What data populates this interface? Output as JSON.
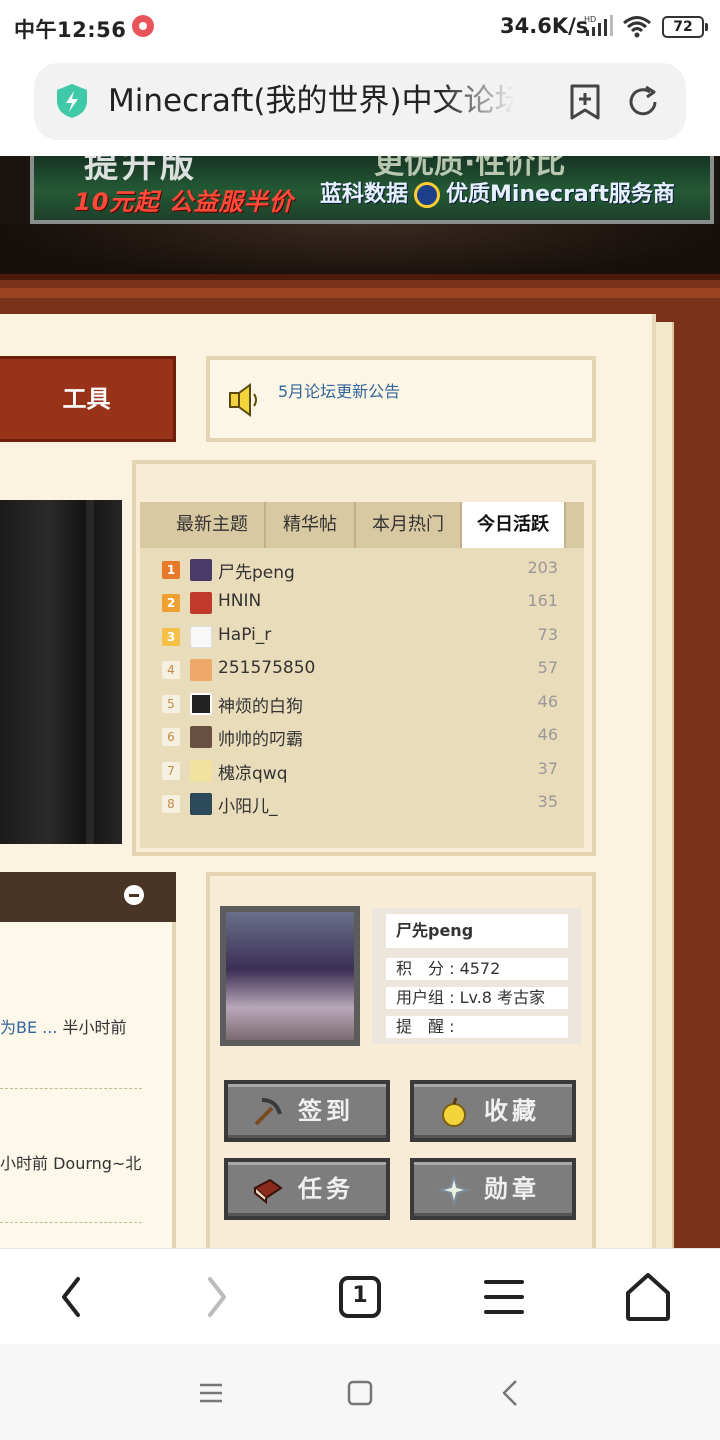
{
  "status_bar": {
    "time": "中午12:56",
    "net_speed": "34.6K/s",
    "battery": "72",
    "icons": [
      "record-icon",
      "signal-hd-icon",
      "wifi-icon",
      "battery-icon"
    ]
  },
  "address_bar": {
    "title": "Minecraft(我的世界)中文论坛",
    "icons": [
      "shield-icon",
      "bookmark-add-icon",
      "reload-icon"
    ]
  },
  "banner": {
    "headline": "提升版",
    "headline_right": "更优质·性价比",
    "left_text": "10元起 公益服半价",
    "right_text_a": "蓝科数据",
    "right_text_b": "优质Minecraft服务商"
  },
  "toolbar": {
    "tools_label": "工具"
  },
  "notice": {
    "link": "5月论坛更新公告"
  },
  "tabs": [
    {
      "label": "最新主题",
      "active": false
    },
    {
      "label": "精华帖",
      "active": false
    },
    {
      "label": "本月热门",
      "active": false
    },
    {
      "label": "今日活跃",
      "active": true
    }
  ],
  "ranking": [
    {
      "rank": "1",
      "name": "尸先peng",
      "score": "203"
    },
    {
      "rank": "2",
      "name": "HNIN",
      "score": "161"
    },
    {
      "rank": "3",
      "name": "HaPi_r",
      "score": "73"
    },
    {
      "rank": "4",
      "name": "251575850",
      "score": "57"
    },
    {
      "rank": "5",
      "name": "神烦的白狗",
      "score": "46"
    },
    {
      "rank": "6",
      "name": "帅帅的叼霸",
      "score": "46"
    },
    {
      "rank": "7",
      "name": "槐凉qwq",
      "score": "37"
    },
    {
      "rank": "8",
      "name": "小阳儿_",
      "score": "35"
    }
  ],
  "posts": [
    {
      "link": "为BE ...",
      "meta": " 半小时前"
    },
    {
      "link": "",
      "meta": "小时前 Dourng~北"
    }
  ],
  "profile": {
    "name": "尸先peng",
    "points": "积　分 : 4572",
    "group": "用户组 : Lv.8 考古家",
    "reminder": "提　醒 :"
  },
  "actions": [
    {
      "label": "签到",
      "icon": "pickaxe-icon"
    },
    {
      "label": "收藏",
      "icon": "golden-apple-icon"
    },
    {
      "label": "任务",
      "icon": "book-icon"
    },
    {
      "label": "勋章",
      "icon": "nether-star-icon"
    }
  ],
  "nav": {
    "tab_count": "1"
  },
  "colors": {
    "accent_link": "#336699",
    "tools_red": "#98331a",
    "frame_wood": "#7a3318",
    "paper": "#fbf3e0"
  }
}
